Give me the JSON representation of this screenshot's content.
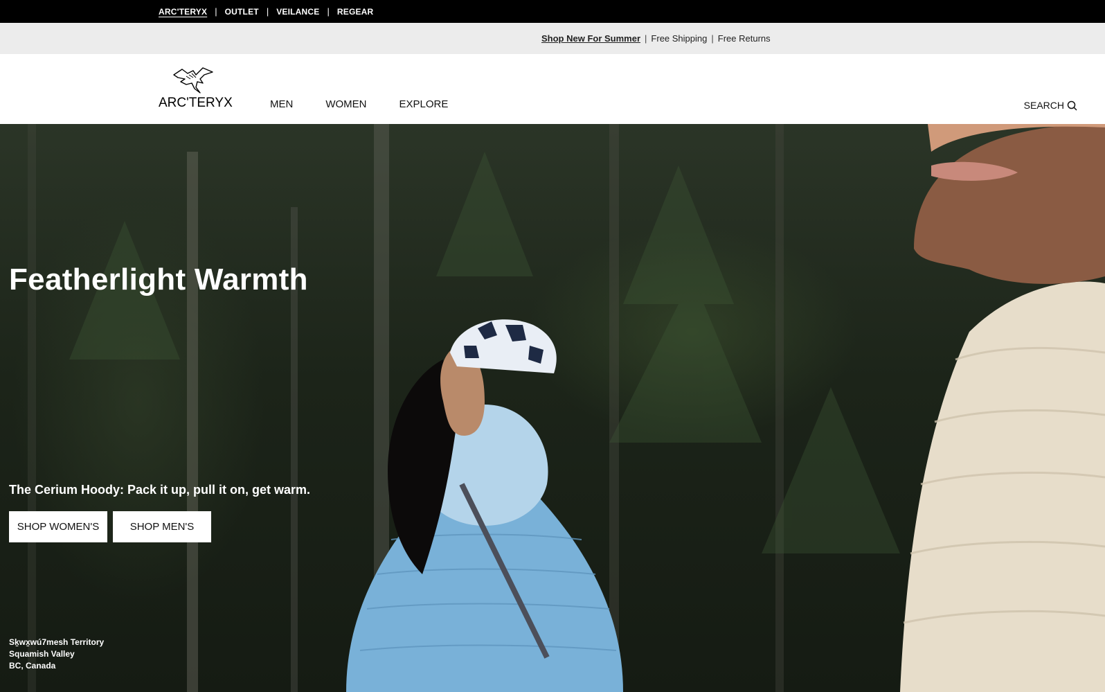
{
  "topbar": {
    "brands": [
      "ARC'TERYX",
      "OUTLET",
      "VEILANCE",
      "REGEAR"
    ]
  },
  "promo": {
    "link": "Shop New For Summer",
    "shipping": "Free Shipping",
    "returns": "Free Returns"
  },
  "header": {
    "logo_text": "ARC'TERYX",
    "nav": [
      "MEN",
      "WOMEN",
      "EXPLORE"
    ],
    "search_label": "SEARCH"
  },
  "hero": {
    "headline": "Featherlight Warmth",
    "subhead": "The Cerium Hoody: Pack it up, pull it on, get warm.",
    "cta_women": "SHOP WOMEN'S",
    "cta_men": "SHOP MEN'S",
    "location": [
      "Sḵwx̱wú7mesh Territory",
      "Squamish Valley",
      "BC, Canada"
    ]
  },
  "colors": {
    "topbar_bg": "#000000",
    "promo_bg": "#ececec",
    "forest": "#1c2419",
    "jacket_blue": "#7fb6db",
    "jacket_cream": "#e6dcc8"
  }
}
